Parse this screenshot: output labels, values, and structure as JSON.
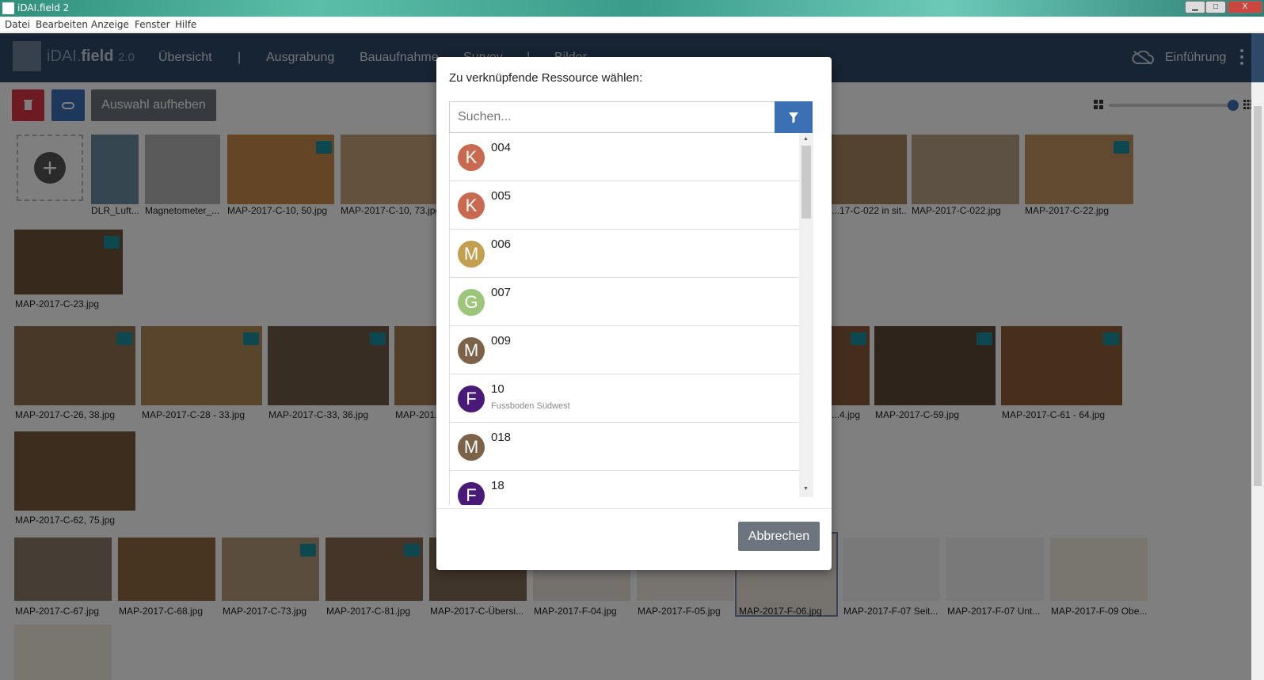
{
  "window": {
    "title": "iDAI.field 2",
    "minimize": "▁",
    "restore": "□",
    "close": "X"
  },
  "menu": [
    "Datei",
    "Bearbeiten",
    "Anzeige",
    "Fenster",
    "Hilfe"
  ],
  "navbar": {
    "brand_light": "iDAI.",
    "brand_bold": "field",
    "brand_version": "2.0",
    "items": [
      "Übersicht",
      "|",
      "Ausgrabung",
      "Bauaufnahme",
      "Survey",
      "|",
      "Bilder"
    ],
    "intro": "Einführung"
  },
  "toolbar": {
    "deselect": "Auswahl aufheben"
  },
  "thumbs": [
    "DLR_Luft...",
    "Magnetometer_...",
    "MAP-2017-C-10, 50.jpg",
    "MAP-2017-C-10, 73.jpg",
    "...17-C-022 in sit...",
    "MAP-2017-C-022.jpg",
    "MAP-2017-C-22.jpg",
    "MAP-2017-C-23.jpg",
    "MAP-2017-C-26, 38.jpg",
    "MAP-2017-C-28 - 33.jpg",
    "MAP-2017-C-33, 36.jpg",
    "MAP-201...",
    "...4.jpg",
    "MAP-2017-C-59.jpg",
    "MAP-2017-C-61 - 64.jpg",
    "MAP-2017-C-62, 75.jpg",
    "MAP-2017-C-67.jpg",
    "MAP-2017-C-68.jpg",
    "MAP-2017-C-73.jpg",
    "MAP-2017-C-81.jpg",
    "MAP-2017-C-Übersi...",
    "MAP-2017-F-04.jpg",
    "MAP-2017-F-05.jpg",
    "MAP-2017-F-06.jpg",
    "MAP-2017-F-07 Seit...",
    "MAP-2017-F-07 Unt...",
    "MAP-2017-F-09 Obe..."
  ],
  "dialog": {
    "title": "Zu verknüpfende Ressource wählen:",
    "search_placeholder": "Suchen...",
    "cancel": "Abbrechen",
    "items": [
      {
        "letter": "K",
        "identifier": "004",
        "short": "",
        "color": "#c96a50"
      },
      {
        "letter": "K",
        "identifier": "005",
        "short": "",
        "color": "#c96a50"
      },
      {
        "letter": "M",
        "identifier": "006",
        "short": "",
        "color": "#c2a050"
      },
      {
        "letter": "G",
        "identifier": "007",
        "short": "",
        "color": "#9dc67a"
      },
      {
        "letter": "M",
        "identifier": "009",
        "short": "",
        "color": "#7c6248"
      },
      {
        "letter": "F",
        "identifier": "10",
        "short": "Fussboden Südwest",
        "color": "#4a1a78"
      },
      {
        "letter": "M",
        "identifier": "018",
        "short": "",
        "color": "#7c6248"
      },
      {
        "letter": "F",
        "identifier": "18",
        "short": "",
        "color": "#4a1a78"
      }
    ]
  }
}
